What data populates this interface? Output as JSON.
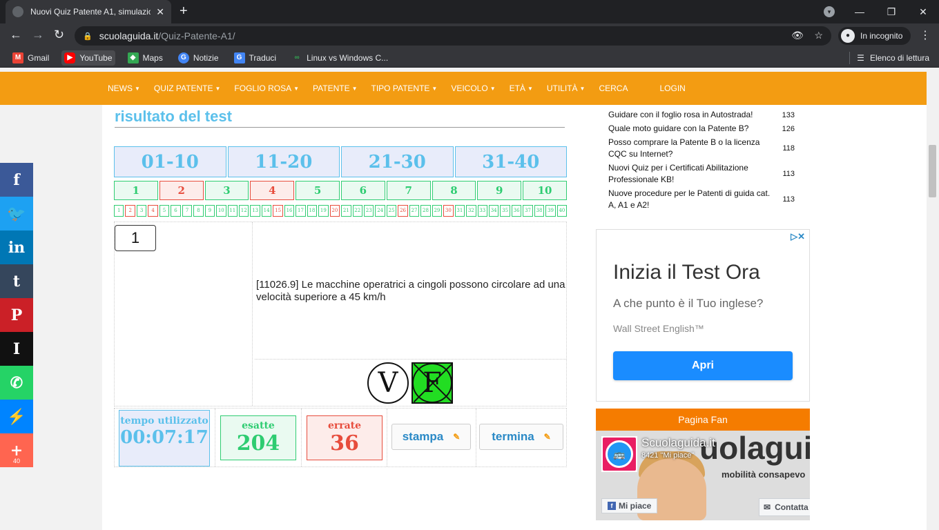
{
  "browser": {
    "tab_title": "Nuovi Quiz Patente A1, simulazio",
    "url_domain": "scuolaguida.it",
    "url_path": "/Quiz-Patente-A1/",
    "incognito_label": "In incognito",
    "bookmarks": [
      "Gmail",
      "YouTube",
      "Maps",
      "Notizie",
      "Traduci",
      "Linux vs Windows C..."
    ],
    "reading_list": "Elenco di lettura"
  },
  "nav": {
    "items": [
      {
        "label": "NEWS",
        "caret": true
      },
      {
        "label": "QUIZ PATENTE",
        "caret": true
      },
      {
        "label": "FOGLIO ROSA",
        "caret": true
      },
      {
        "label": "PATENTE",
        "caret": true
      },
      {
        "label": "TIPO PATENTE",
        "caret": true
      },
      {
        "label": "VEICOLO",
        "caret": true
      },
      {
        "label": "ETÀ",
        "caret": true
      },
      {
        "label": "UTILITÀ",
        "caret": true
      },
      {
        "label": "CERCA",
        "caret": false
      },
      {
        "label": "LOGIN",
        "caret": false
      }
    ]
  },
  "main": {
    "title": "risultato del test",
    "groups": [
      "01-10",
      "11-20",
      "21-30",
      "31-40"
    ],
    "questions10": [
      {
        "n": "1",
        "wrong": false
      },
      {
        "n": "2",
        "wrong": true
      },
      {
        "n": "3",
        "wrong": false
      },
      {
        "n": "4",
        "wrong": true
      },
      {
        "n": "5",
        "wrong": false
      },
      {
        "n": "6",
        "wrong": false
      },
      {
        "n": "7",
        "wrong": false
      },
      {
        "n": "8",
        "wrong": false
      },
      {
        "n": "9",
        "wrong": false
      },
      {
        "n": "10",
        "wrong": false
      }
    ],
    "wrong40": [
      2,
      4,
      15,
      20,
      26,
      30
    ],
    "question_number": "1",
    "question_text": "[11026.9] Le macchine operatrici a cingoli possono circolare ad una velocità superiore a 45 km/h",
    "answer_true": "V",
    "answer_false": "F",
    "stats": {
      "time_label": "tempo utilizzato",
      "time_value": "00:07:17",
      "correct_label": "esatte",
      "correct_value": "204",
      "wrong_label": "errate",
      "wrong_value": "36"
    },
    "print_button": "stampa",
    "end_button": "termina"
  },
  "sidebar": {
    "recent": [
      {
        "title": "Guidare con il foglio rosa in Autostrada!",
        "count": "133"
      },
      {
        "title": "Quale moto guidare con la Patente B?",
        "count": "126"
      },
      {
        "title": "Posso comprare la Patente B o la licenza CQC su Internet?",
        "count": "118"
      },
      {
        "title": "Nuovi Quiz per i Certificati Abilitazione Professionale KB!",
        "count": "113"
      },
      {
        "title": "Nuove procedure per le Patenti di guida cat. A, A1 e A2!",
        "count": "113"
      }
    ],
    "ad": {
      "headline": "Inizia il Test Ora",
      "subline": "A che punto è il Tuo inglese?",
      "brand": "Wall Street English™",
      "button": "Apri"
    },
    "fanpage": {
      "header": "Pagina Fan",
      "page_name": "Scuolaguida.it",
      "likes": "8421 \"Mi piace\"",
      "big_text": "uolaguida.i",
      "tagline": "mobilità consapevo",
      "like_button": "Mi piace",
      "contact_button": "Contatta"
    }
  },
  "share": {
    "count": "40",
    "colors": {
      "facebook": "#3b5998",
      "twitter": "#1da1f2",
      "linkedin": "#0077b5",
      "tumblr": "#35465c",
      "pinterest": "#cb2027",
      "instapaper": "#111111",
      "whatsapp": "#25d366",
      "messenger": "#0084ff",
      "more": "#ff6550"
    }
  }
}
